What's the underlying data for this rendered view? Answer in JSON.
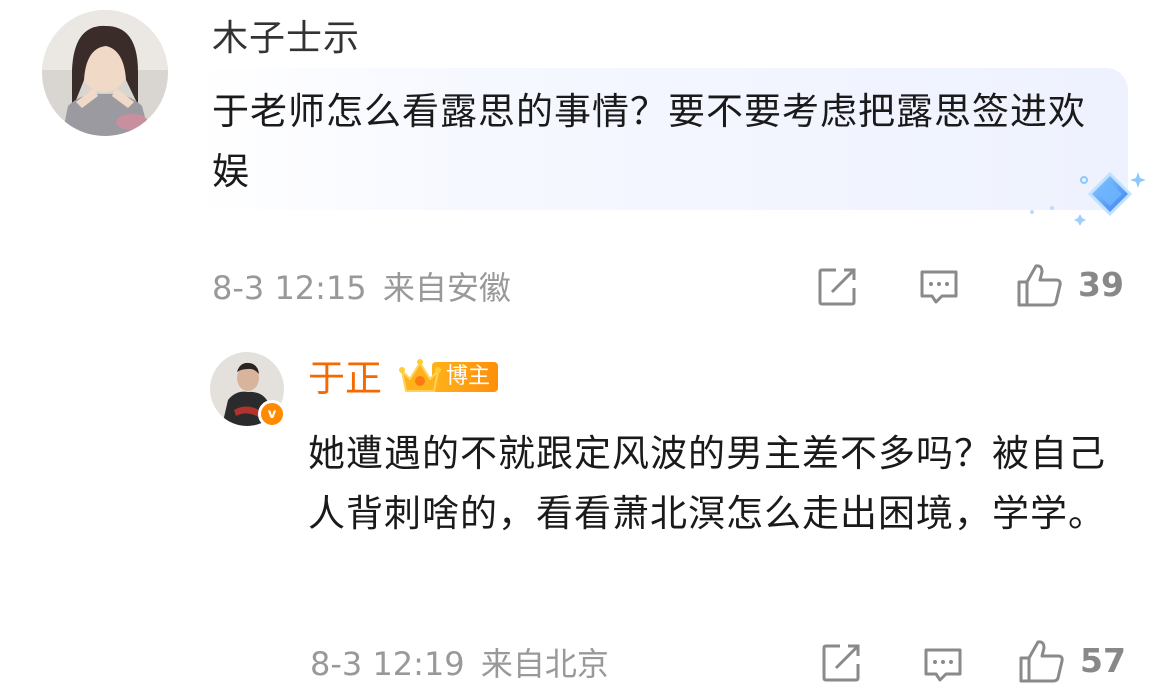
{
  "comment": {
    "author": "木子士示",
    "text": "于老师怎么看露思的事情？要不要考虑把露思签进欢娱",
    "timestamp": "8-3 12:15",
    "location": "来自安徽",
    "likes": "39",
    "icons": [
      "avatar-photo",
      "diamond-badge-icon",
      "share-icon",
      "comment-icon",
      "like-icon"
    ]
  },
  "reply": {
    "author": "于正",
    "author_badge": "博主",
    "verified_badge": "v",
    "text": "她遭遇的不就跟定风波的男主差不多吗？被自己人背刺啥的，看看萧北溟怎么走出困境，学学。",
    "timestamp": "8-3 12:19",
    "location": "来自北京",
    "likes": "57",
    "icons": [
      "avatar-photo",
      "crown-icon",
      "verified-v-icon",
      "share-icon",
      "comment-icon",
      "like-icon"
    ]
  },
  "colors": {
    "accent_orange": "#f56a00",
    "meta_gray": "#999999",
    "bubble_blue": "#eef2fe"
  }
}
